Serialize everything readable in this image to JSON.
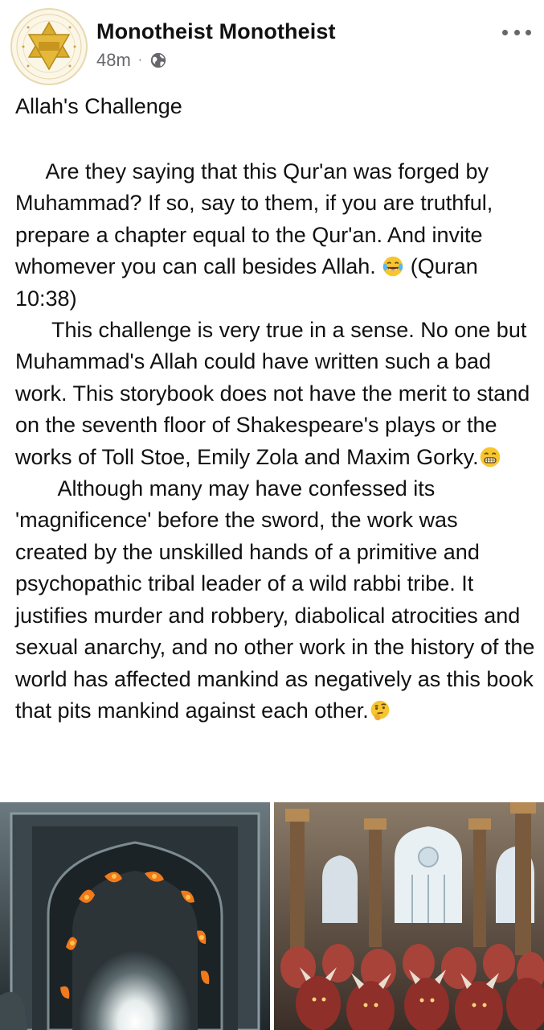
{
  "post": {
    "author": "Monotheist Monotheist",
    "time": "48m",
    "separator": "·",
    "privacy_icon": "globe-icon",
    "more_icon": "more-options-icon",
    "title": "Allah's Challenge",
    "paragraphs": [
      {
        "text": "     Are they saying that this Qur'an was forged by Muhammad? If so, say to them, if you are truthful, prepare a chapter equal to the Qur'an. And invite whomever you can call besides Allah. ",
        "emoji": "face-with-tears-of-joy",
        "after": " (Quran 10:38)"
      },
      {
        "text": "      This challenge is very true in a sense. No one but Muhammad's Allah could have written such a bad work. This storybook does not have the merit to stand on the seventh floor of Shakespeare's plays or the works of Toll Stoe, Emily Zola and Maxim Gorky.",
        "emoji": "grinning-face-with-smiling-eyes",
        "after": ""
      },
      {
        "text": "       Although many may have confessed its 'magnificence' before the sword, the work was created by the unskilled hands of a primitive and psychopathic tribal leader of a wild rabbi tribe. It justifies murder and robbery, diabolical atrocities and sexual anarchy, and no other work in the history of the world has affected mankind as negatively as this book that pits mankind against each other.",
        "emoji": "thinking-face",
        "after": ""
      }
    ],
    "images": [
      {
        "name": "burning-mosque-doorway-image"
      },
      {
        "name": "crowd-of-demons-image"
      }
    ]
  },
  "colors": {
    "text": "#111111",
    "meta": "#65676b",
    "avatar_gold": "#d4a62a"
  }
}
